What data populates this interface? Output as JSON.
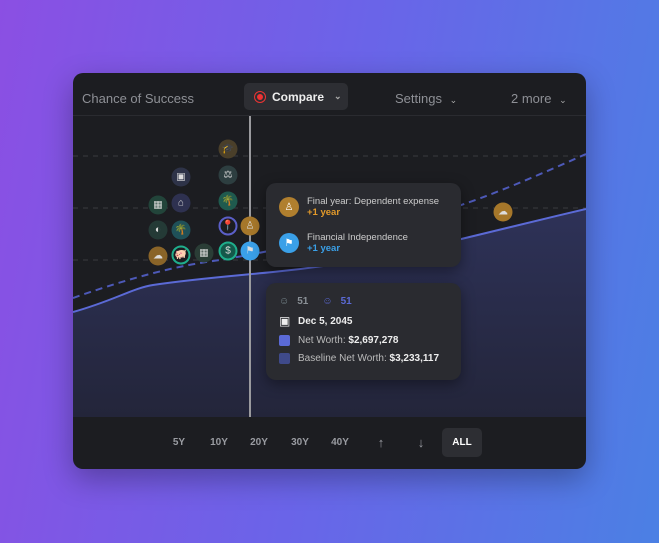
{
  "header": {
    "title": "Chance of Success",
    "compare": "Compare",
    "settings": "Settings",
    "more": "2 more"
  },
  "tooltip_events": [
    {
      "label": "Final year: Dependent expense",
      "delta": "+1 year",
      "color": "#c88a2e",
      "icon": "person-icon"
    },
    {
      "label": "Financial Independence",
      "delta": "+1 year",
      "color": "#3aa0e8",
      "icon": "flag-icon"
    }
  ],
  "tooltip_values": {
    "age1": "51",
    "age2": "51",
    "date": "Dec 5, 2045",
    "net_worth_label": "Net Worth:",
    "net_worth": "$2,697,278",
    "baseline_label": "Baseline Net Worth:",
    "baseline": "$3,233,117",
    "net_worth_color": "#5b6ad6",
    "baseline_color": "#3f4a8a"
  },
  "ranges": [
    "5Y",
    "10Y",
    "20Y",
    "30Y",
    "40Y",
    "↑",
    "↓",
    "ALL"
  ],
  "selected_range": "ALL"
}
